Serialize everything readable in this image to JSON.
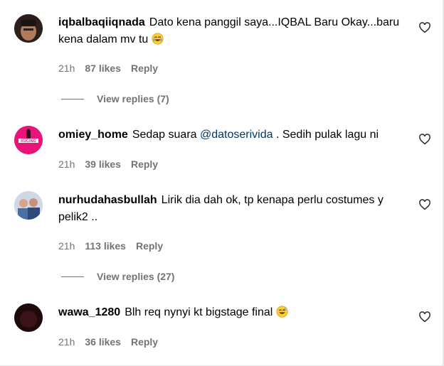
{
  "comments": [
    {
      "username": "iqbalbaqiiqnada",
      "text": "Dato kena panggil saya...IQBAL Baru Okay...baru kena dalam mv tu",
      "time": "21h",
      "likes": "87 likes",
      "reply": "Reply",
      "view_replies": "View replies (7)",
      "avatar_color": "#3a2a24"
    },
    {
      "username": "omiey_home",
      "text_before": "Sedap suara",
      "mention": "@datoserivida",
      "text_after": ". Sedih pulak lagu ni",
      "time": "21h",
      "likes": "39 likes",
      "reply": "Reply",
      "avatar_color": "#e8147a",
      "avatar_text": "KUCING"
    },
    {
      "username": "nurhudahasbullah",
      "text": "Lirik dia dah ok, tp kenapa perlu costumes y pelik2 ..",
      "time": "21h",
      "likes": "113 likes",
      "reply": "Reply",
      "view_replies": "View replies (27)",
      "avatar_color": "#8fb3d9"
    },
    {
      "username": "wawa_1280",
      "text": "Blh req nynyi kt bigstage final",
      "time": "21h",
      "likes": "36 likes",
      "reply": "Reply",
      "avatar_color": "#2a0f10"
    }
  ],
  "icons": {
    "like": "heart-outline-icon",
    "emoji_laugh": "grinning-sweat-emoji",
    "emoji_sweat": "grinning-sweat-emoji"
  },
  "colors": {
    "meta": "#737373",
    "mention": "#00376b"
  }
}
